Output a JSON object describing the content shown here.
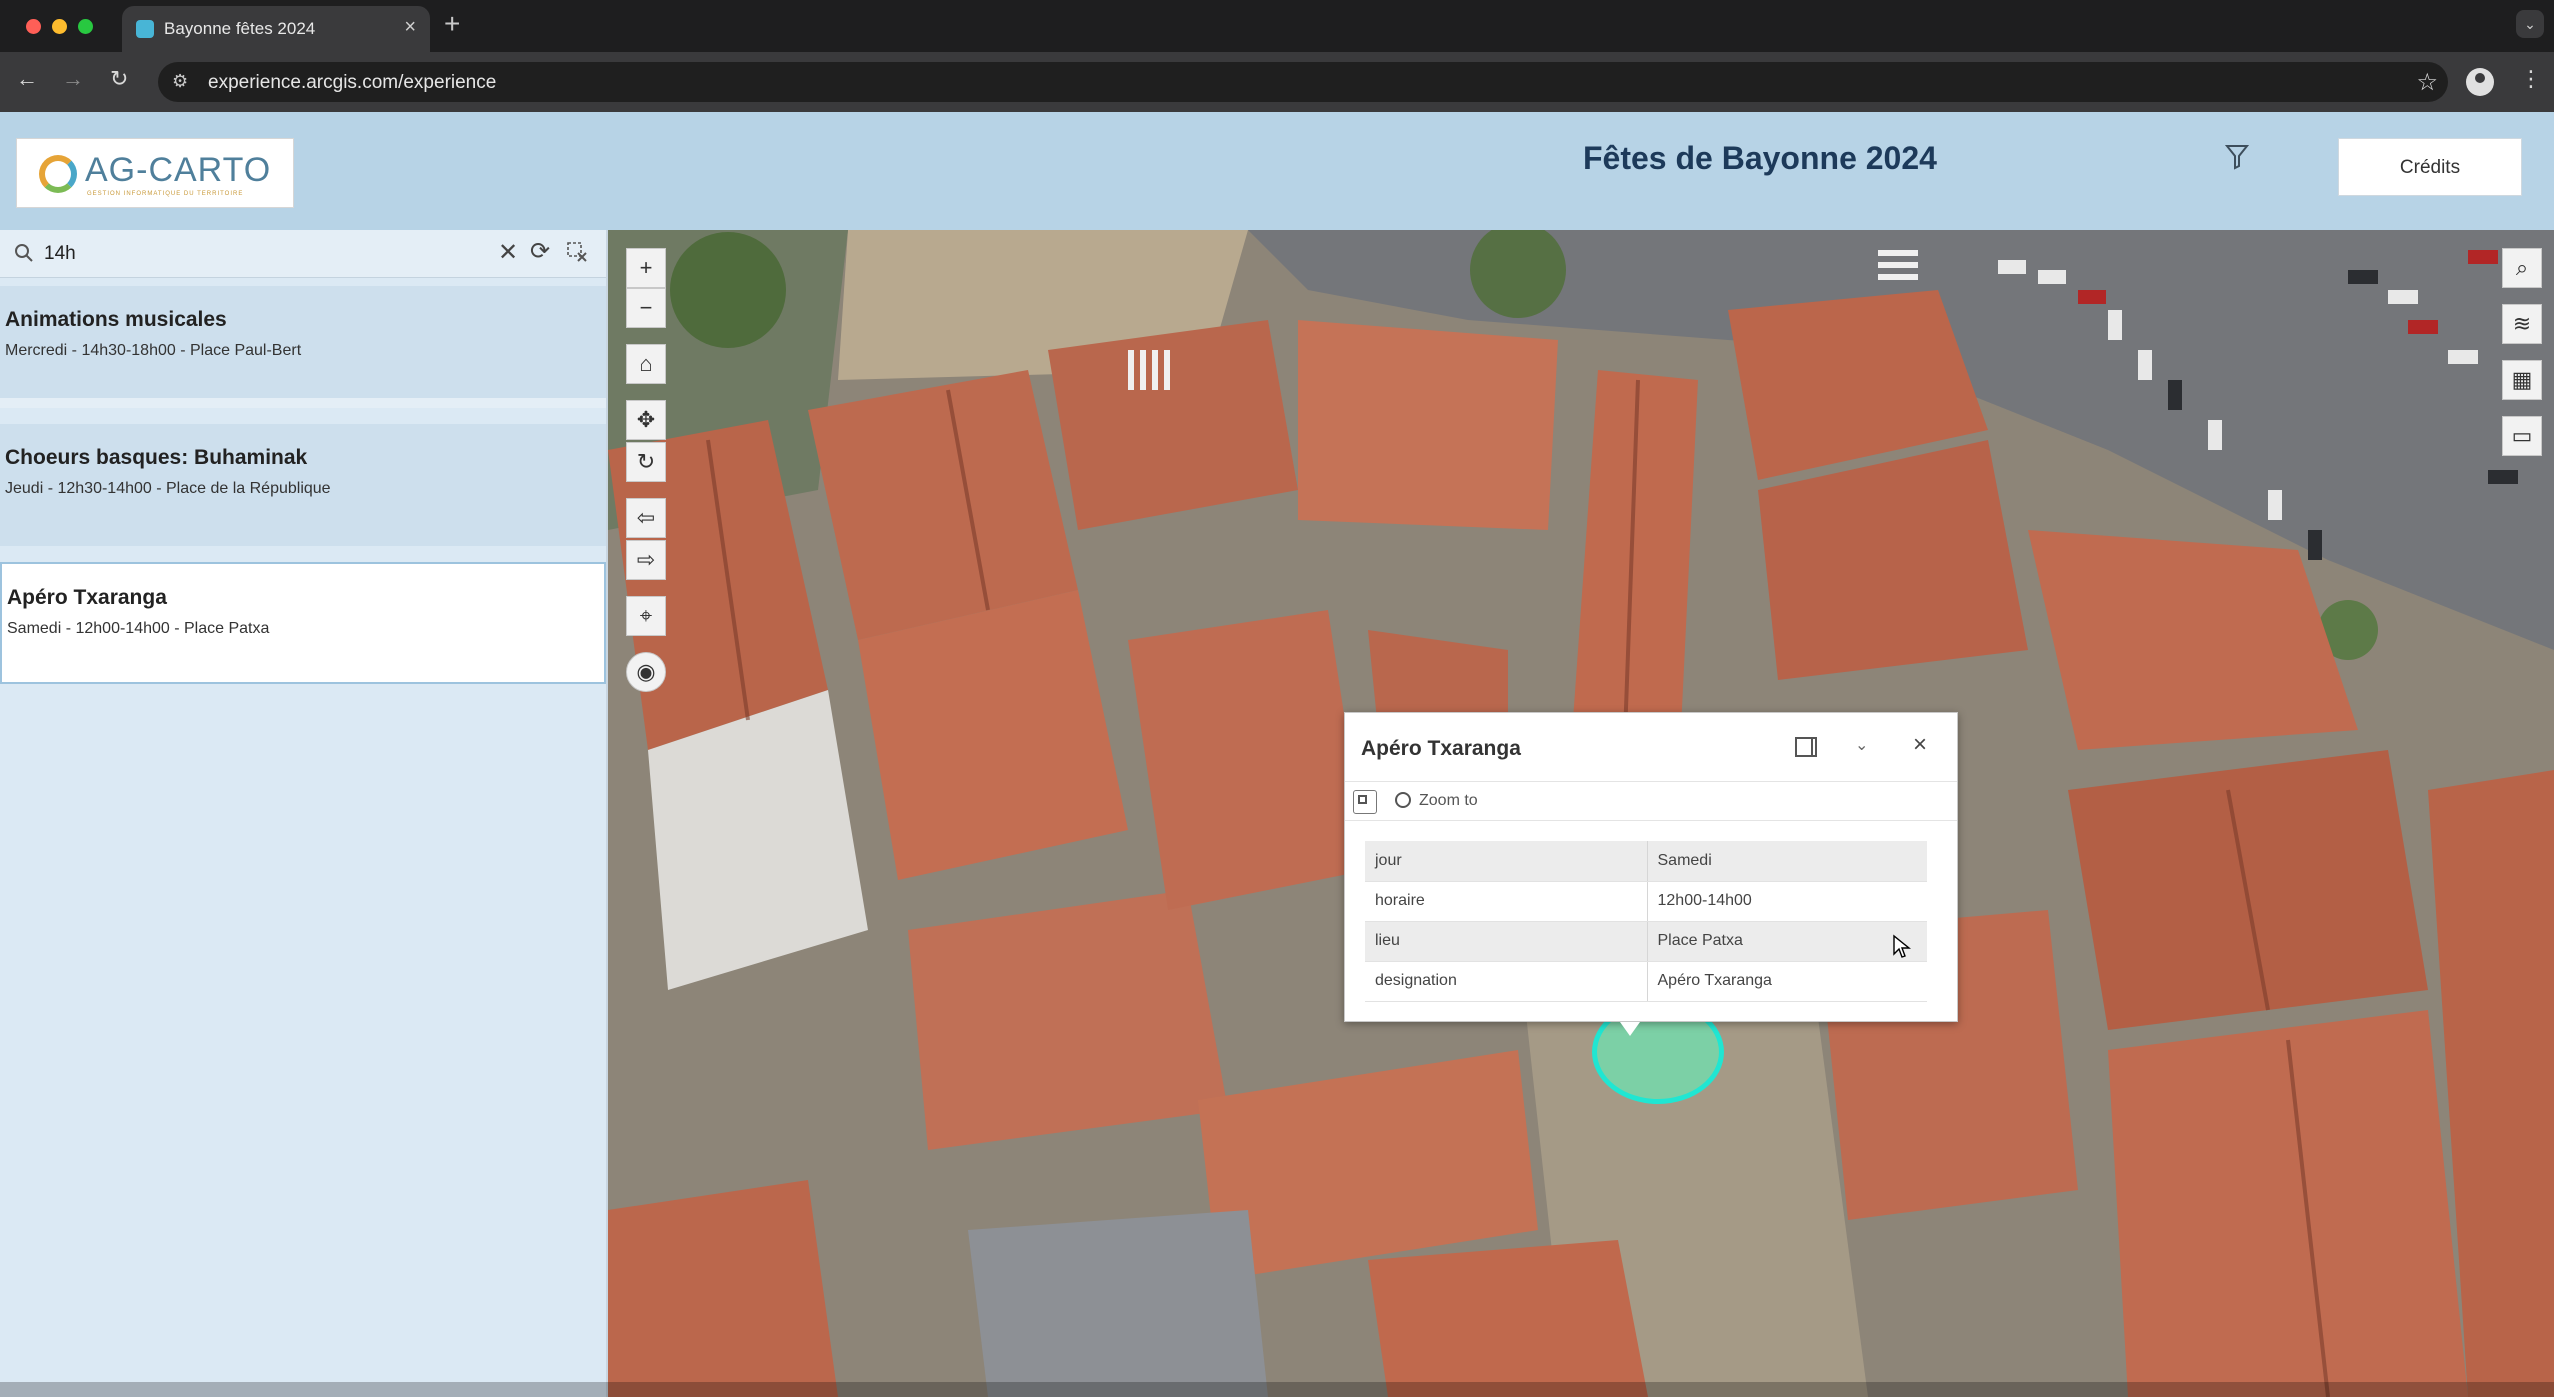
{
  "browser": {
    "tab_title": "Bayonne fêtes 2024",
    "tab_close_icon": "close-icon",
    "new_tab_glyph": "+",
    "url": "experience.arcgis.com/experience"
  },
  "header": {
    "logo_text": "AG-CARTO",
    "logo_subtext": "GESTION INFORMATIQUE DU TERRITOIRE",
    "title": "Fêtes de Bayonne 2024",
    "credits_label": "Crédits",
    "accent_color": "#b7d3e6"
  },
  "search": {
    "value": "14h",
    "clear_glyph": "✕",
    "refresh_glyph": "⟳"
  },
  "list": {
    "items": [
      {
        "title": "Animations musicales",
        "subtitle": "Mercredi  - 14h30-18h00 - Place Paul-Bert"
      },
      {
        "title": "Choeurs basques: Buhaminak",
        "subtitle": "Jeudi  - 12h30-14h00 - Place de la République"
      },
      {
        "title": "Apéro Txaranga",
        "subtitle": "Samedi  - 12h00-14h00 - Place Patxa"
      }
    ]
  },
  "map_tools": {
    "zoom_in": "+",
    "zoom_out": "−",
    "left_icons": [
      "home-icon",
      "pan-icon",
      "rotate-icon",
      "previous-view-icon",
      "next-view-icon",
      "compass-icon",
      "navigation-toggle-icon"
    ],
    "right_icons": [
      "search-icon",
      "layers-icon",
      "basemap-gallery-icon",
      "measure-icon"
    ]
  },
  "popup": {
    "title": "Apéro Txaranga",
    "zoom_to_label": "Zoom to",
    "close_glyph": "×",
    "collapse_glyph": "⌄",
    "rows": [
      {
        "field": "jour",
        "value": "Samedi"
      },
      {
        "field": "horaire",
        "value": "12h00-14h00"
      },
      {
        "field": "lieu",
        "value": "Place Patxa"
      },
      {
        "field": "designation",
        "value": "Apéro Txaranga"
      }
    ]
  },
  "colors": {
    "marker_stroke": "#20e6d2",
    "roof": "#b5634a",
    "panel_bg": "#dbe9f4"
  }
}
